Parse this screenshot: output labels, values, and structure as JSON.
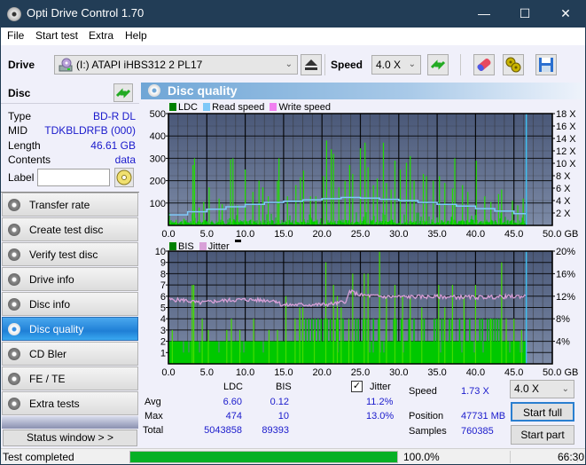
{
  "window": {
    "title": "Opti Drive Control 1.70",
    "minimize": "—",
    "maximize": "☐",
    "close": "✕"
  },
  "menu": [
    "File",
    "Start test",
    "Extra",
    "Help"
  ],
  "toolbar": {
    "drive_label": "Drive",
    "drive_value": "(I:)  ATAPI iHBS312   2 PL17",
    "speed_label": "Speed",
    "speed_value": "4.0 X",
    "icons": [
      "drive-icon",
      "eject-icon",
      "refresh-icon",
      "eraser-icon",
      "settings-icon",
      "save-icon"
    ]
  },
  "disc": {
    "header": "Disc",
    "type_label": "Type",
    "type_value": "BD-R DL",
    "mid_label": "MID",
    "mid_value": "TDKBLDRFB (000)",
    "length_label": "Length",
    "length_value": "46.61 GB",
    "contents_label": "Contents",
    "contents_value": "data",
    "label_label": "Label",
    "label_value": ""
  },
  "nav": [
    {
      "label": "Transfer rate",
      "active": false
    },
    {
      "label": "Create test disc",
      "active": false
    },
    {
      "label": "Verify test disc",
      "active": false
    },
    {
      "label": "Drive info",
      "active": false
    },
    {
      "label": "Disc info",
      "active": false
    },
    {
      "label": "Disc quality",
      "active": true
    },
    {
      "label": "CD Bler",
      "active": false
    },
    {
      "label": "FE / TE",
      "active": false
    },
    {
      "label": "Extra tests",
      "active": false
    }
  ],
  "status_window_button": "Status window > >",
  "panel_title": "Disc quality",
  "colors": {
    "ldc": "#00c800",
    "bis": "#00c800",
    "read_speed": "#7ec8f8",
    "write_speed": "#f080f0",
    "jitter": "#d8a0d8",
    "plot_bg_top": "#4a5878",
    "plot_bg_bottom": "#7c8aa6",
    "end_marker": "#40c0f0"
  },
  "chart_data": [
    {
      "type": "bar",
      "title": "LDC / Read speed",
      "legend": [
        "LDC",
        "Read speed",
        "Write speed"
      ],
      "legend_position": "top-left",
      "xlabel": "GB",
      "x_ticks": [
        "0.0",
        "5.0",
        "10.0",
        "15.0",
        "20.0",
        "25.0",
        "30.0",
        "35.0",
        "40.0",
        "45.0",
        "50.0 GB"
      ],
      "xlim": [
        0,
        50
      ],
      "ylim": [
        0,
        500
      ],
      "y_ticks": [
        "500",
        "400",
        "300",
        "200",
        "100"
      ],
      "y2lim": [
        0,
        18
      ],
      "y2_ticks": [
        "18 X",
        "16 X",
        "14 X",
        "12 X",
        "10 X",
        "8 X",
        "6 X",
        "4 X",
        "2 X"
      ],
      "grid": true,
      "data_end_gb": 46.61,
      "ldc_peaks": [
        [
          0.2,
          20
        ],
        [
          1.0,
          25
        ],
        [
          2.0,
          30
        ],
        [
          3.2,
          270
        ],
        [
          3.4,
          300
        ],
        [
          4.0,
          80
        ],
        [
          4.6,
          105
        ],
        [
          5.3,
          170
        ],
        [
          6.6,
          120
        ],
        [
          7.0,
          95
        ],
        [
          8.1,
          295
        ],
        [
          8.4,
          300
        ],
        [
          9.0,
          90
        ],
        [
          10.0,
          250
        ],
        [
          11.0,
          150
        ],
        [
          11.8,
          200
        ],
        [
          12.3,
          170
        ],
        [
          13.0,
          130
        ],
        [
          14.2,
          200
        ],
        [
          14.4,
          300
        ],
        [
          15.5,
          130
        ],
        [
          16.6,
          180
        ],
        [
          17.2,
          215
        ],
        [
          17.6,
          245
        ],
        [
          18.5,
          130
        ],
        [
          19.2,
          130
        ],
        [
          20.2,
          220
        ],
        [
          20.6,
          380
        ],
        [
          21.2,
          340
        ],
        [
          21.5,
          320
        ],
        [
          22.2,
          170
        ],
        [
          23.0,
          200
        ],
        [
          23.6,
          270
        ],
        [
          24.0,
          230
        ],
        [
          25.0,
          345
        ],
        [
          25.6,
          370
        ],
        [
          26.0,
          260
        ],
        [
          26.7,
          180
        ],
        [
          27.2,
          210
        ],
        [
          28.0,
          370
        ],
        [
          28.4,
          190
        ],
        [
          29.0,
          160
        ],
        [
          29.5,
          290
        ],
        [
          30.2,
          250
        ],
        [
          31.0,
          280
        ],
        [
          31.5,
          310
        ],
        [
          32.0,
          200
        ],
        [
          33.2,
          230
        ],
        [
          33.6,
          220
        ],
        [
          34.5,
          200
        ],
        [
          35.3,
          220
        ],
        [
          36.0,
          190
        ],
        [
          37.0,
          165
        ],
        [
          37.3,
          300
        ],
        [
          38.3,
          180
        ],
        [
          39.0,
          150
        ],
        [
          40.1,
          290
        ],
        [
          41.2,
          130
        ],
        [
          42.0,
          105
        ],
        [
          43.0,
          140
        ],
        [
          43.4,
          160
        ],
        [
          44.8,
          110
        ],
        [
          45.5,
          90
        ],
        [
          46.2,
          120
        ]
      ],
      "read_speed_x": [
        0,
        2.5,
        5,
        7.5,
        10,
        12.5,
        15,
        17.5,
        20,
        22.5,
        25,
        27.5,
        30,
        32.5,
        35,
        37.5,
        40,
        42.5,
        45,
        46.6
      ],
      "read_speed_y": [
        1.7,
        2.2,
        2.6,
        3.0,
        3.4,
        3.7,
        3.9,
        4.1,
        4.3,
        4.5,
        4.4,
        4.2,
        4.0,
        3.7,
        3.4,
        3.1,
        2.7,
        2.3,
        1.9,
        1.7
      ]
    },
    {
      "type": "bar",
      "title": "BIS / Jitter",
      "legend": [
        "BIS",
        "Jitter"
      ],
      "legend_position": "top-left",
      "xlabel": "GB",
      "x_ticks": [
        "0.0",
        "5.0",
        "10.0",
        "15.0",
        "20.0",
        "25.0",
        "30.0",
        "35.0",
        "40.0",
        "45.0",
        "50.0 GB"
      ],
      "xlim": [
        0,
        50
      ],
      "ylim": [
        0,
        10
      ],
      "y_ticks": [
        "10",
        "9",
        "8",
        "7",
        "6",
        "5",
        "4",
        "3",
        "2",
        "1"
      ],
      "y2lim": [
        0,
        20
      ],
      "y2_ticks": [
        "20%",
        "16%",
        "12%",
        "8%",
        "4%"
      ],
      "grid": true,
      "data_end_gb": 46.61,
      "bis_baseline": 2,
      "bis_peaks": [
        [
          0.5,
          3
        ],
        [
          3.1,
          7
        ],
        [
          3.3,
          7
        ],
        [
          4.4,
          4
        ],
        [
          5.2,
          3
        ],
        [
          7.6,
          3
        ],
        [
          8.2,
          4
        ],
        [
          9.3,
          3
        ],
        [
          11.1,
          4
        ],
        [
          13.1,
          3
        ],
        [
          14.2,
          3
        ],
        [
          15.3,
          6
        ],
        [
          16.5,
          4
        ],
        [
          17.1,
          5
        ],
        [
          17.5,
          5
        ],
        [
          19.0,
          3
        ],
        [
          20.5,
          9
        ],
        [
          21.5,
          7
        ],
        [
          22.0,
          6
        ],
        [
          22.5,
          5
        ],
        [
          23.5,
          4
        ],
        [
          24.0,
          8
        ],
        [
          25.5,
          8
        ],
        [
          26.0,
          8
        ],
        [
          27.5,
          10
        ],
        [
          28.4,
          6
        ],
        [
          29.5,
          7
        ],
        [
          30.5,
          6
        ],
        [
          31.5,
          6
        ],
        [
          33.0,
          5
        ],
        [
          35.2,
          7
        ],
        [
          36.0,
          5
        ],
        [
          37.0,
          7
        ],
        [
          38.5,
          6
        ],
        [
          40.0,
          7
        ],
        [
          42.0,
          4
        ],
        [
          43.4,
          9
        ],
        [
          44.0,
          4
        ],
        [
          45.0,
          4
        ],
        [
          46.0,
          3
        ]
      ],
      "jitter_x": [
        0,
        2,
        4,
        6,
        8,
        10,
        12,
        14,
        14.8,
        17,
        20,
        22,
        23.2,
        23.6,
        25,
        28,
        32,
        36,
        40,
        44,
        46.6
      ],
      "jitter_y": [
        11.4,
        11.3,
        10.8,
        11.1,
        11.3,
        11.4,
        11.3,
        11.2,
        10.4,
        10.5,
        10.5,
        10.7,
        11.2,
        12.9,
        12.2,
        11.9,
        11.9,
        11.9,
        11.8,
        11.9,
        12.0
      ]
    }
  ],
  "stats": {
    "col_ldc": "LDC",
    "col_bis": "BIS",
    "jitter_label": "Jitter",
    "jitter_checked": true,
    "avg_label": "Avg",
    "avg_ldc": "6.60",
    "avg_bis": "0.12",
    "avg_jitter": "11.2%",
    "max_label": "Max",
    "max_ldc": "474",
    "max_bis": "10",
    "max_jitter": "13.0%",
    "total_label": "Total",
    "total_ldc": "5043858",
    "total_bis": "89393",
    "speed_label": "Speed",
    "speed_value": "1.73 X",
    "position_label": "Position",
    "position_value": "47731 MB",
    "samples_label": "Samples",
    "samples_value": "760385",
    "speed_select": "4.0 X",
    "start_full": "Start full",
    "start_part": "Start part"
  },
  "statusbar": {
    "text": "Test completed",
    "progress": 1.0,
    "progress_text": "100.0%",
    "time": "66:30"
  }
}
